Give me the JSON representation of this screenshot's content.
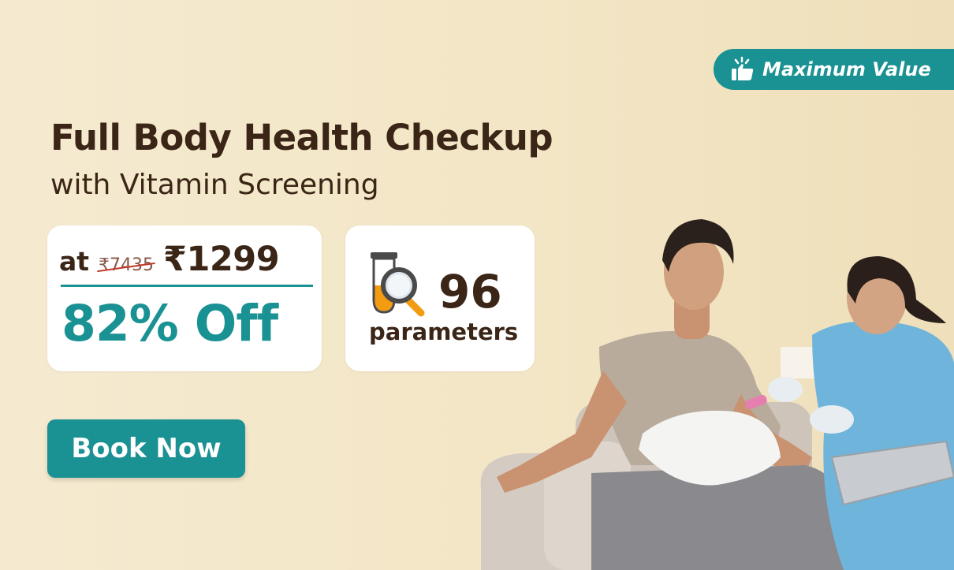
{
  "badge": {
    "icon": "thumbs-up-icon",
    "label": "Maximum Value"
  },
  "headline": {
    "title": "Full Body Health Checkup",
    "subtitle": "with Vitamin Screening"
  },
  "pricing": {
    "prefix": "at",
    "original_price": "₹7435",
    "offer_price": "₹1299",
    "discount": "82% Off"
  },
  "parameters": {
    "icon": "test-tube-magnifier-icon",
    "count": "96",
    "label": "parameters"
  },
  "cta": {
    "label": "Book Now"
  },
  "colors": {
    "accent": "#1a9193",
    "text_dark": "#3b2516",
    "background": "#f4e8c9",
    "card": "#ffffff"
  }
}
